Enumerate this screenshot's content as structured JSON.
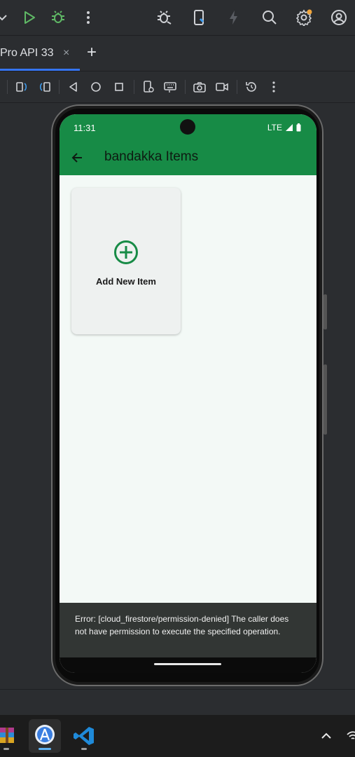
{
  "toolbar": {
    "icons": [
      "chevron-down-icon",
      "run-icon",
      "debug-icon",
      "more-icon",
      "attach-debugger-icon",
      "device-manager-icon",
      "apply-changes-icon",
      "search-icon",
      "settings-icon",
      "account-icon"
    ],
    "run_color": "#5fb865",
    "debug_color": "#5fb865"
  },
  "tabs": {
    "active_label": "Pro API 33",
    "close_symbol": "×",
    "add_symbol": "+"
  },
  "emulator_toolbar": {
    "icons": [
      "rotate-left-icon",
      "rotate-right-icon",
      "back-icon",
      "home-icon",
      "overview-icon",
      "device-settings-icon",
      "keyboard-icon",
      "screenshot-icon",
      "record-icon",
      "snapshot-icon",
      "more-icon"
    ]
  },
  "phone": {
    "status": {
      "time": "11:31",
      "network": "LTE"
    },
    "appbar": {
      "title": "bandakka Items",
      "color": "#178b46"
    },
    "add_card": {
      "label": "Add New Item"
    },
    "snackbar": {
      "message": "Error: [cloud_firestore/permission-denied] The caller does not have permission to execute the specified operation."
    }
  },
  "taskbar": {
    "apps": [
      "winrar-icon",
      "android-studio-icon",
      "vscode-icon"
    ],
    "tray": [
      "chevron-up-icon",
      "wifi-icon"
    ]
  }
}
